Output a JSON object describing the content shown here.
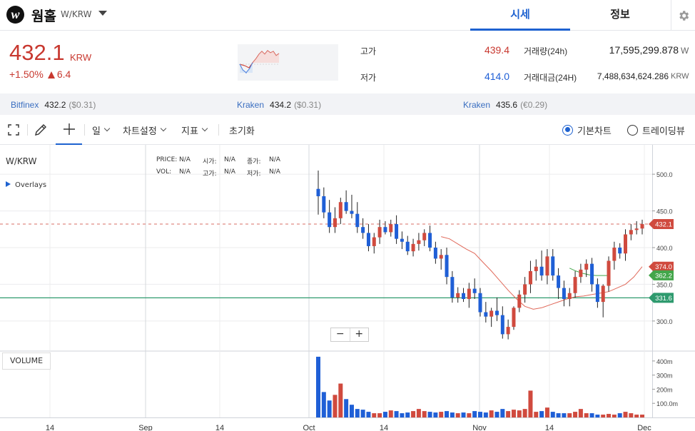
{
  "header": {
    "logo_letter": "w",
    "coin_name": "웜홀",
    "pair": "W/KRW",
    "tabs": [
      {
        "label": "시세",
        "active": true
      },
      {
        "label": "정보",
        "active": false
      }
    ],
    "settings_icon": "gear-icon"
  },
  "summary": {
    "price": "432.1",
    "unit": "KRW",
    "change_pct": "+1.50%",
    "change_abs": "6.4",
    "high_label": "고가",
    "high": "439.4",
    "low_label": "저가",
    "low": "414.0",
    "volume_label": "거래량(24h)",
    "volume": "17,595,299.878",
    "volume_unit": "W",
    "amount_label": "거래대금(24H)",
    "amount": "7,488,634,624.286",
    "amount_unit": "KRW"
  },
  "exchanges": [
    {
      "name": "Bitfinex",
      "price": "432.2",
      "sub": "($0.31)"
    },
    {
      "name": "Kraken",
      "price": "434.2",
      "sub": "($0.31)"
    },
    {
      "name": "Kraken",
      "price": "435.6",
      "sub": "(€0.29)"
    }
  ],
  "toolbar": {
    "interval": "일",
    "chart_settings": "차트설정",
    "indicators": "지표",
    "reset": "초기화",
    "basic_chart": "기본차트",
    "tradingview": "트레이딩뷰"
  },
  "chart": {
    "title": "W/KRW",
    "overlays_label": "Overlays",
    "ohlc": {
      "price_label": "PRICE:",
      "price": "N/A",
      "open_label": "시가:",
      "open": "N/A",
      "close_label": "종가:",
      "close": "N/A",
      "vol_label": "VOL:",
      "vol": "N/A",
      "high_label": "고가:",
      "high": "N/A",
      "low_label": "저가:",
      "low": "N/A"
    },
    "zoom_out": "−",
    "zoom_in": "+",
    "volume_label": "VOLUME"
  },
  "colors": {
    "up": "#d04a3e",
    "down": "#1f5fd6",
    "accent": "#1e62d0",
    "ma_red": "#e0695a",
    "ma_green": "#43a64a",
    "hline": "#2e9a6e"
  },
  "chart_data": {
    "type": "candlestick",
    "title": "W/KRW",
    "x_ticks": [
      "14",
      "Sep",
      "14",
      "Oct",
      "14",
      "Nov",
      "14",
      "Dec"
    ],
    "y_ticks": [
      300,
      350,
      400,
      450,
      500
    ],
    "y_tick_labels": [
      "300.0",
      "350.0",
      "400.0",
      "450.0",
      "500.0"
    ],
    "ylim": [
      260,
      540
    ],
    "volume_ticks": [
      100,
      200,
      300,
      400
    ],
    "volume_tick_labels": [
      "100.0m",
      "200m",
      "300m",
      "400m"
    ],
    "volume_ylim": [
      0,
      460
    ],
    "price_tags": [
      {
        "value": 432.1,
        "label": "432.1",
        "color": "#d04a3e",
        "line": "dashed"
      },
      {
        "value": 374.0,
        "label": "374.0",
        "color": "#d04a3e",
        "line": "none"
      },
      {
        "value": 362.2,
        "label": "362.2",
        "color": "#43a64a",
        "line": "none"
      },
      {
        "value": 331.6,
        "label": "331.6",
        "color": "#2e9a6e",
        "line": "solid"
      }
    ],
    "candles": [
      [
        480,
        505,
        445,
        470
      ],
      [
        470,
        482,
        440,
        448
      ],
      [
        448,
        465,
        420,
        428
      ],
      [
        428,
        455,
        420,
        440
      ],
      [
        440,
        468,
        432,
        462
      ],
      [
        462,
        478,
        446,
        450
      ],
      [
        450,
        472,
        440,
        446
      ],
      [
        446,
        462,
        420,
        428
      ],
      [
        428,
        440,
        412,
        420
      ],
      [
        420,
        432,
        395,
        402
      ],
      [
        402,
        420,
        392,
        414
      ],
      [
        414,
        438,
        405,
        428
      ],
      [
        428,
        436,
        418,
        421
      ],
      [
        421,
        438,
        415,
        432
      ],
      [
        432,
        444,
        405,
        412
      ],
      [
        412,
        422,
        398,
        408
      ],
      [
        408,
        416,
        390,
        395
      ],
      [
        395,
        412,
        388,
        405
      ],
      [
        405,
        420,
        396,
        410
      ],
      [
        410,
        425,
        402,
        420
      ],
      [
        420,
        430,
        395,
        400
      ],
      [
        400,
        408,
        378,
        385
      ],
      [
        385,
        398,
        370,
        390
      ],
      [
        390,
        400,
        350,
        360
      ],
      [
        360,
        368,
        325,
        332
      ],
      [
        332,
        346,
        325,
        338
      ],
      [
        338,
        345,
        326,
        330
      ],
      [
        330,
        352,
        318,
        344
      ],
      [
        344,
        358,
        330,
        338
      ],
      [
        338,
        345,
        306,
        312
      ],
      [
        312,
        326,
        298,
        306
      ],
      [
        306,
        318,
        292,
        314
      ],
      [
        314,
        332,
        300,
        308
      ],
      [
        308,
        320,
        276,
        282
      ],
      [
        282,
        302,
        275,
        292
      ],
      [
        292,
        320,
        288,
        318
      ],
      [
        318,
        342,
        312,
        336
      ],
      [
        336,
        360,
        325,
        350
      ],
      [
        350,
        382,
        338,
        368
      ],
      [
        368,
        384,
        355,
        374
      ],
      [
        374,
        396,
        355,
        362
      ],
      [
        362,
        398,
        350,
        388
      ],
      [
        388,
        398,
        355,
        362
      ],
      [
        362,
        372,
        330,
        345
      ],
      [
        345,
        355,
        320,
        330
      ],
      [
        330,
        345,
        320,
        338
      ],
      [
        338,
        368,
        332,
        360
      ],
      [
        360,
        378,
        352,
        370
      ],
      [
        370,
        384,
        360,
        378
      ],
      [
        378,
        386,
        340,
        350
      ],
      [
        350,
        358,
        318,
        326
      ],
      [
        326,
        350,
        305,
        348
      ],
      [
        348,
        388,
        340,
        382
      ],
      [
        382,
        408,
        370,
        400
      ],
      [
        400,
        406,
        385,
        392
      ],
      [
        392,
        425,
        382,
        418
      ],
      [
        418,
        432,
        410,
        424
      ],
      [
        424,
        436,
        418,
        426
      ],
      [
        426,
        438,
        418,
        432
      ]
    ],
    "volume_m": [
      430,
      180,
      120,
      160,
      240,
      130,
      90,
      60,
      55,
      40,
      30,
      30,
      40,
      50,
      45,
      30,
      35,
      45,
      60,
      45,
      40,
      35,
      40,
      45,
      35,
      30,
      35,
      30,
      45,
      40,
      35,
      50,
      40,
      60,
      45,
      55,
      50,
      60,
      190,
      40,
      45,
      70,
      40,
      30,
      30,
      30,
      40,
      60,
      30,
      30,
      20,
      20,
      25,
      20,
      30,
      40,
      30,
      20,
      20
    ],
    "moving_averages": [
      {
        "color": "#e0695a",
        "values": [
          415,
          412,
          405,
          398,
          392,
          380,
          368,
          355,
          342,
          330,
          320,
          316,
          318,
          322,
          326,
          330,
          333,
          334,
          336,
          338,
          340,
          345,
          350,
          360,
          374
        ]
      },
      {
        "color": "#43a64a",
        "values": [
          372,
          368,
          365,
          363,
          362,
          362,
          362
        ]
      }
    ]
  }
}
